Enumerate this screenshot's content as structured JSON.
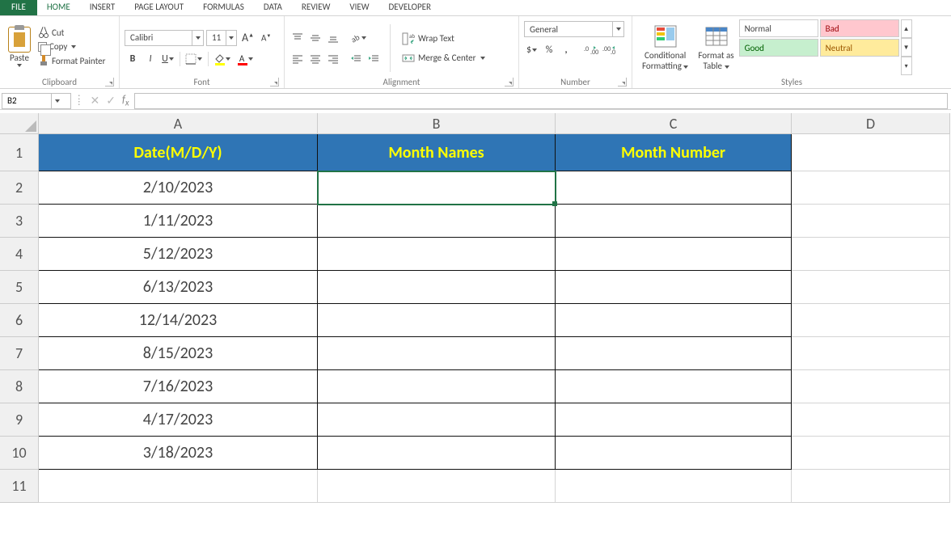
{
  "tabs": {
    "file": "FILE",
    "home": "HOME",
    "insert": "INSERT",
    "pagelayout": "PAGE LAYOUT",
    "formulas": "FORMULAS",
    "data": "DATA",
    "review": "REVIEW",
    "view": "VIEW",
    "developer": "DEVELOPER"
  },
  "clipboard": {
    "paste": "Paste",
    "cut": "Cut",
    "copy": "Copy",
    "fp": "Format Painter",
    "title": "Clipboard"
  },
  "font": {
    "name": "Calibri",
    "size": "11",
    "grow": "A",
    "shrink": "A",
    "bold": "B",
    "italic": "I",
    "underline": "U",
    "title": "Font"
  },
  "alignment": {
    "wrap": "Wrap Text",
    "merge": "Merge & Center",
    "title": "Alignment"
  },
  "number": {
    "format": "General",
    "title": "Number"
  },
  "cond": {
    "l1": "Conditional",
    "l2": "Formatting"
  },
  "tbl": {
    "l1": "Format as",
    "l2": "Table"
  },
  "styles": {
    "normal": "Normal",
    "bad": "Bad",
    "good": "Good",
    "neutral": "Neutral",
    "title": "Styles"
  },
  "namebox": "B2",
  "cols": [
    "A",
    "B",
    "C",
    "D"
  ],
  "rows": [
    "1",
    "2",
    "3",
    "4",
    "5",
    "6",
    "7",
    "8",
    "9",
    "10",
    "11"
  ],
  "header": {
    "A": "Date(M/D/Y)",
    "B": "Month Names",
    "C": "Month Number"
  },
  "data": [
    {
      "A": "2/10/2023",
      "B": "",
      "C": ""
    },
    {
      "A": "1/11/2023",
      "B": "",
      "C": ""
    },
    {
      "A": "5/12/2023",
      "B": "",
      "C": ""
    },
    {
      "A": "6/13/2023",
      "B": "",
      "C": ""
    },
    {
      "A": "12/14/2023",
      "B": "",
      "C": ""
    },
    {
      "A": "8/15/2023",
      "B": "",
      "C": ""
    },
    {
      "A": "7/16/2023",
      "B": "",
      "C": ""
    },
    {
      "A": "4/17/2023",
      "B": "",
      "C": ""
    },
    {
      "A": "3/18/2023",
      "B": "",
      "C": ""
    }
  ]
}
